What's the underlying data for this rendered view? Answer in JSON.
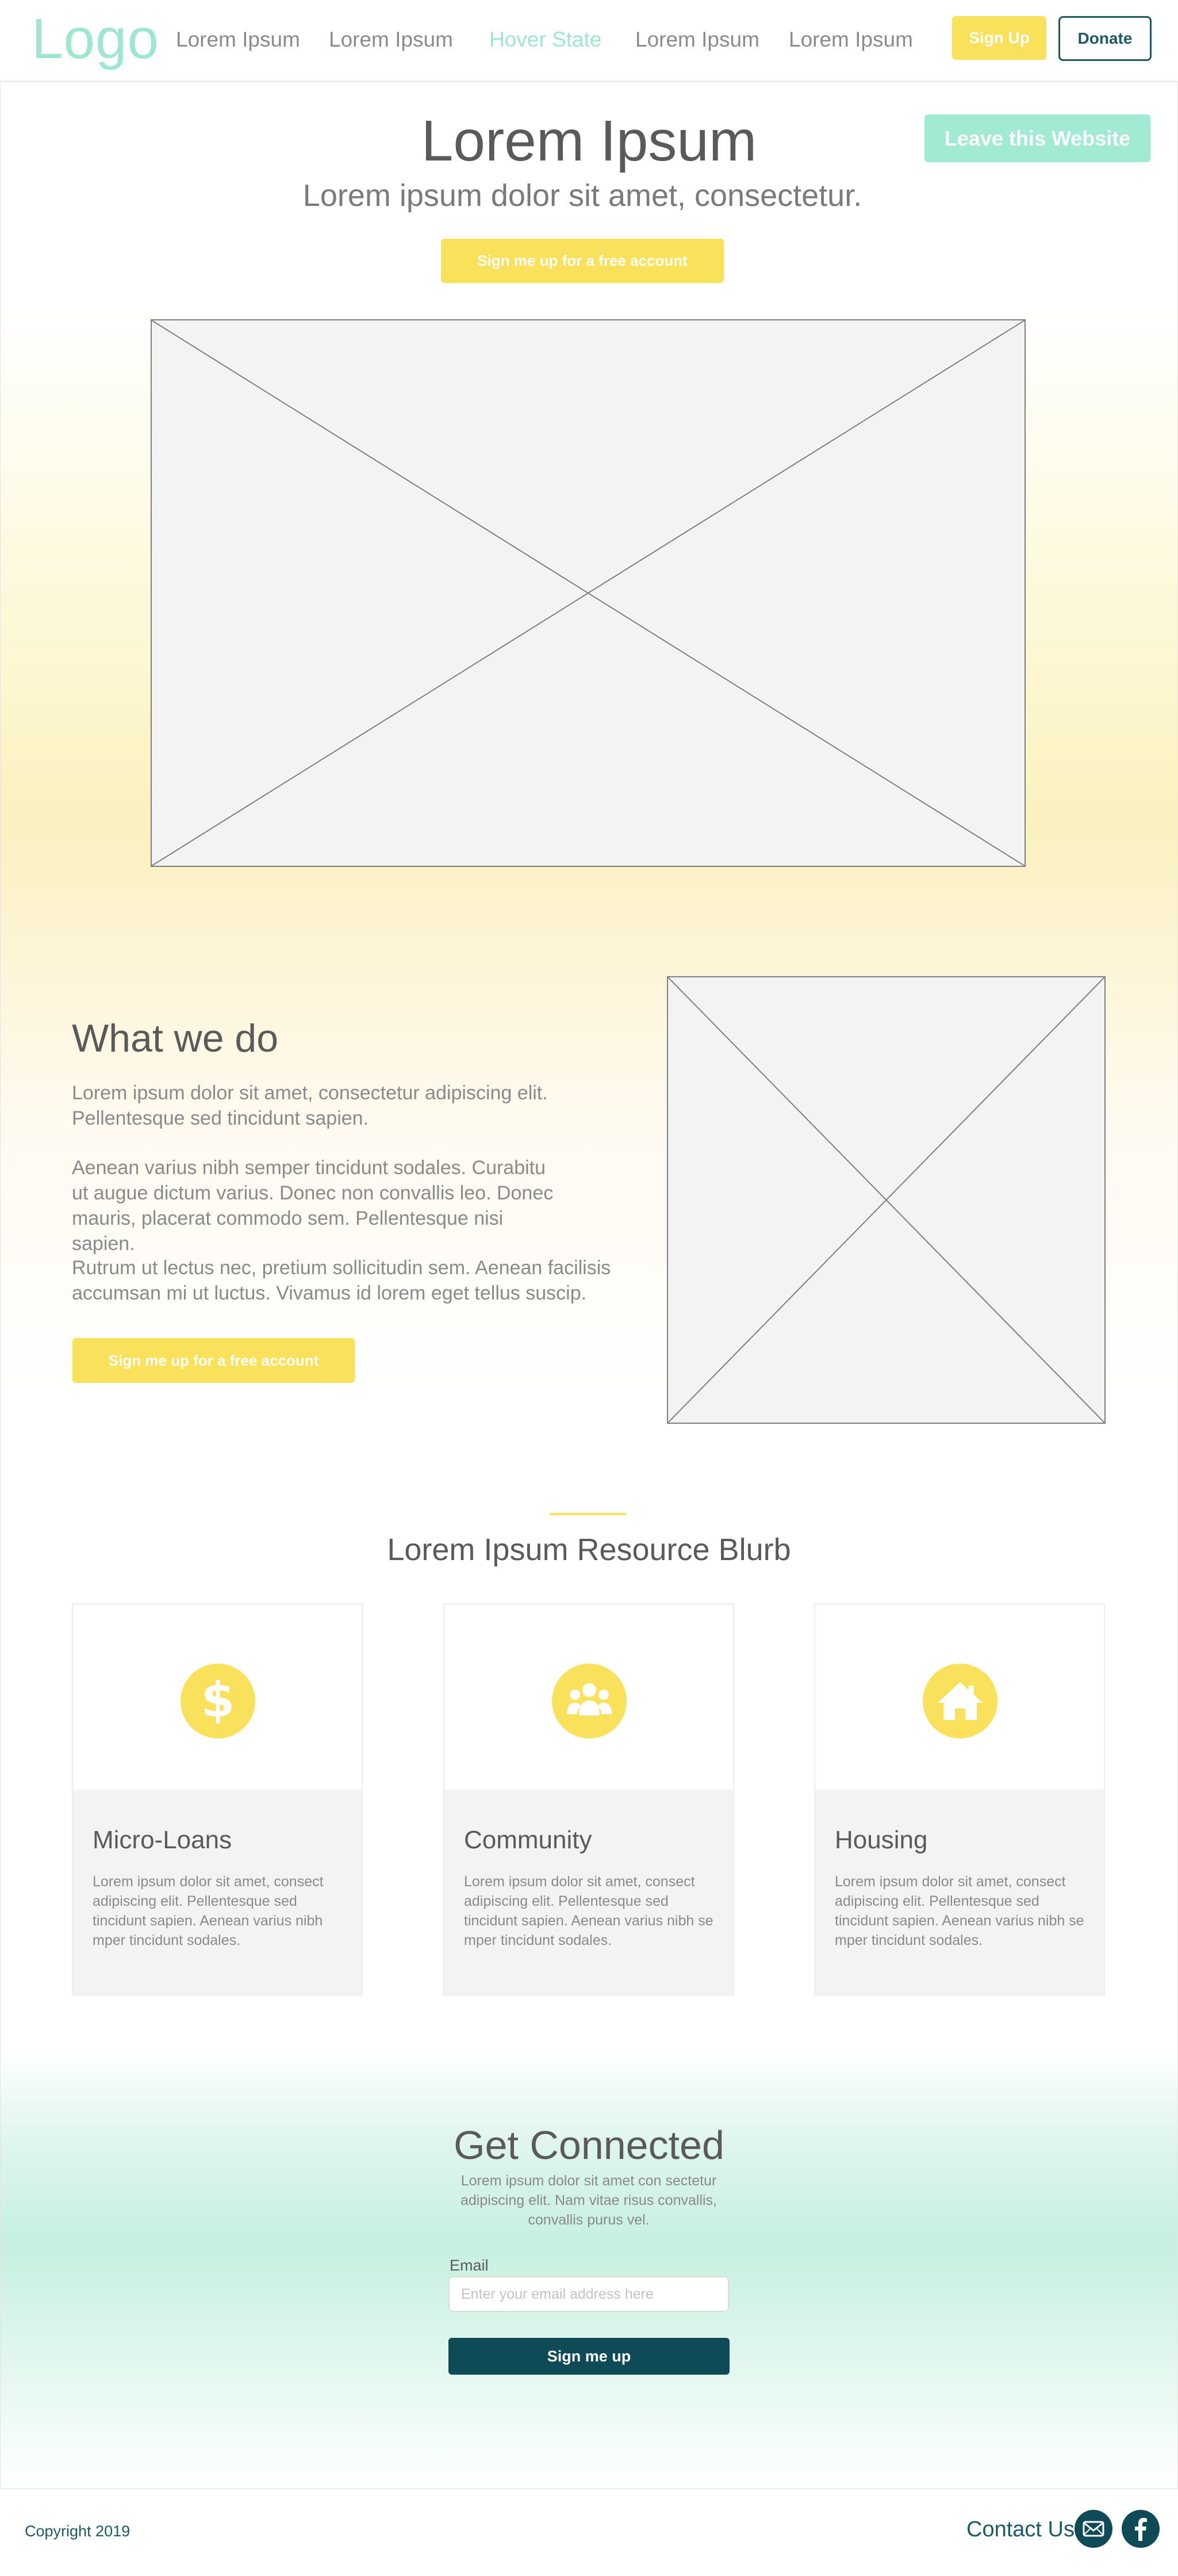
{
  "header": {
    "logo": "Logo",
    "nav": [
      "Lorem Ipsum",
      "Lorem Ipsum",
      "Hover State",
      "Lorem Ipsum",
      "Lorem Ipsum"
    ],
    "signup_label": "Sign Up",
    "donate_label": "Donate"
  },
  "hero": {
    "title": "Lorem Ipsum",
    "subtitle": "Lorem ipsum dolor sit amet, consectetur.",
    "leave_label": "Leave this Website",
    "cta_label": "Sign me up for a free account"
  },
  "what_we_do": {
    "title": "What we do",
    "paragraphs": [
      "Lorem ipsum dolor sit amet, consectetur adipiscing elit. Pellentesque sed tincidunt sapien.",
      "Aenean varius nibh semper tincidunt sodales. Curabitu ut augue dictum varius. Donec non convallis leo. Donec mauris, placerat commodo sem. Pellentesque nisi sapien.",
      "Rutrum ut lectus nec, pretium sollicitudin sem. Aenean facilisis accumsan mi ut luctus. Vivamus id lorem eget tellus suscip."
    ],
    "cta_label": "Sign me up for a free account"
  },
  "resources": {
    "title": "Lorem Ipsum Resource Blurb",
    "cards": [
      {
        "icon": "dollar-icon",
        "title": "Micro-Loans",
        "text": "Lorem ipsum dolor sit amet, consect adipiscing elit. Pellentesque sed tincidunt sapien. Aenean varius nibh mper tincidunt sodales."
      },
      {
        "icon": "people-icon",
        "title": "Community",
        "text": "Lorem ipsum dolor sit amet, consect adipiscing elit. Pellentesque sed tincidunt sapien. Aenean varius nibh se mper tincidunt sodales."
      },
      {
        "icon": "home-icon",
        "title": "Housing",
        "text": "Lorem ipsum dolor sit amet, consect adipiscing elit. Pellentesque sed tincidunt sapien. Aenean varius nibh se mper tincidunt sodales."
      }
    ]
  },
  "get_connected": {
    "title": "Get Connected",
    "text": "Lorem ipsum dolor sit amet con sectetur adipiscing elit. Nam vitae risus convallis, convallis purus vel.",
    "email_label": "Email",
    "email_value": "",
    "email_placeholder": "Enter your email address here",
    "submit_label": "Sign me up"
  },
  "footer": {
    "copyright": "Copyright 2019",
    "contact_label": "Contact Us",
    "social_icons": [
      "mail-icon",
      "facebook-icon"
    ]
  },
  "colors": {
    "brand_mint": "#9fe6d2",
    "accent_yellow": "#f9e15b",
    "dark_teal": "#0f4b57",
    "text_gray": "#5a5a5a"
  }
}
